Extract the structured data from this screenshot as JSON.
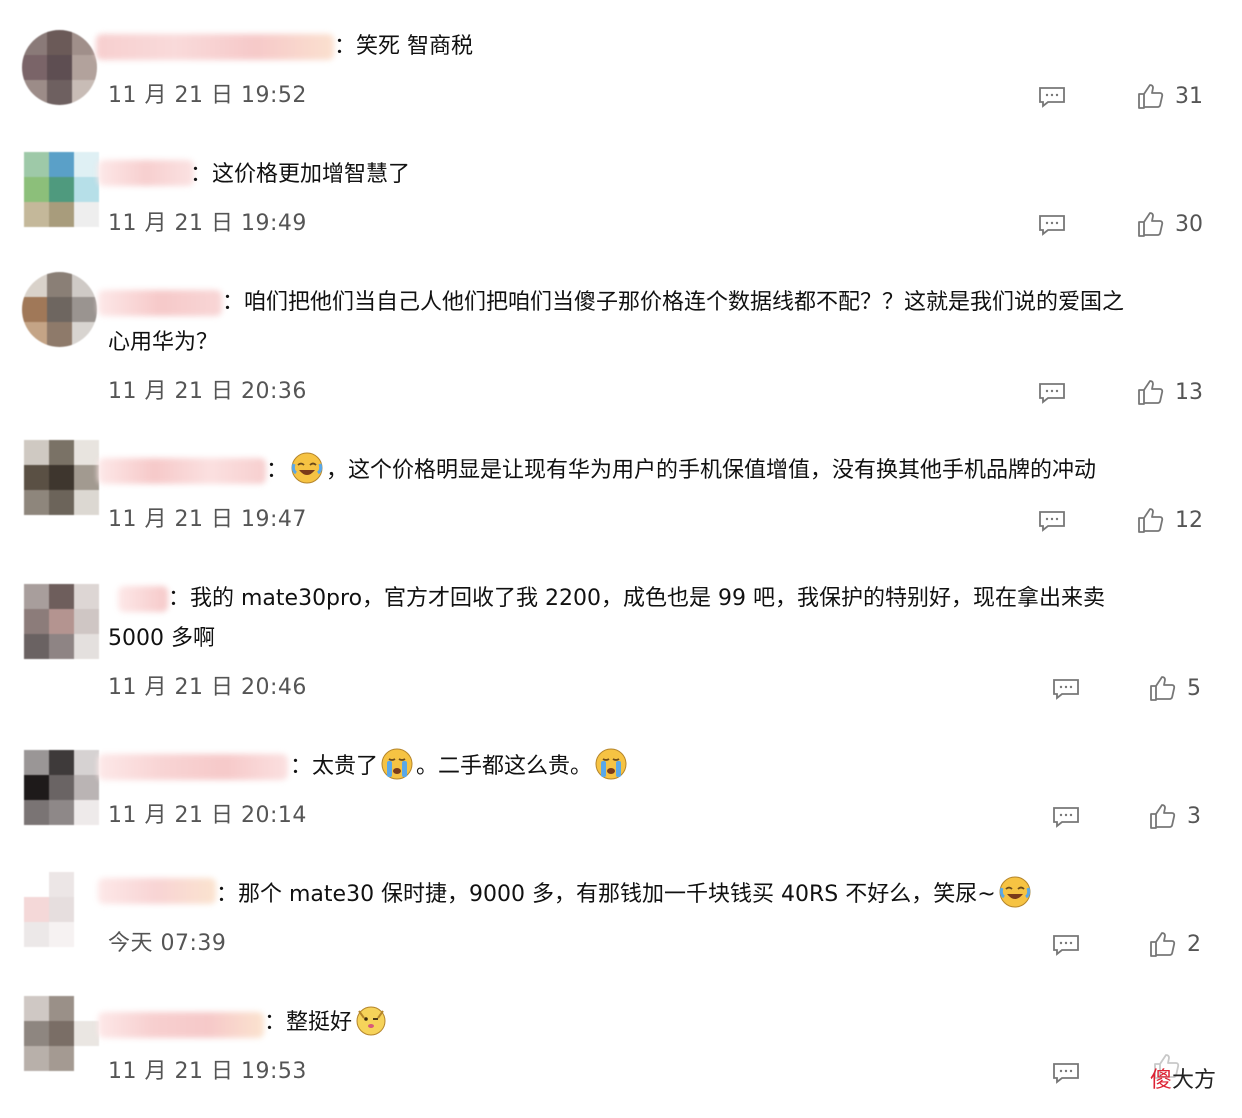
{
  "comments": [
    {
      "text_parts": [
        "：笑死 智商税"
      ],
      "time": "11 月 21 日 19:52",
      "like_count": "31"
    },
    {
      "text_parts": [
        "：这价格更加增智慧了"
      ],
      "time": "11 月 21 日 19:49",
      "like_count": "30"
    },
    {
      "text_line1": "：咱们把他们当自己人他们把咱们当傻子那价格连个数据线都不配？？这就是我们说的爱国之",
      "text_line2": "心用华为？",
      "time": "11 月 21 日 20:36",
      "like_count": "13"
    },
    {
      "text_before": "：",
      "text_after": "，这个价格明显是让现有华为用户的手机保值增值，没有换其他手机品牌的冲动",
      "emoji": "laughing-crying-emoji",
      "time": "11 月 21 日 19:47",
      "like_count": "12"
    },
    {
      "text_line1": "：我的 mate30pro，官方才回收了我 2200，成色也是 99 吧，我保护的特别好，现在拿出来卖",
      "text_line2": "5000 多啊",
      "time": "11 月 21 日 20:46",
      "like_count": "5"
    },
    {
      "text_a": "：太贵了",
      "text_b": "。二手都这么贵。",
      "emoji": "crying-emoji",
      "time": "11 月 21 日 20:14",
      "like_count": "3"
    },
    {
      "text_a": "：那个 mate30 保时捷，9000 多，有那钱加一千块钱买 40RS 不好么，笑尿~",
      "emoji": "laughing-crying-emoji",
      "time": "今天 07:39",
      "like_count": "2"
    },
    {
      "text_a": "：整挺好",
      "emoji": "doge-emoji",
      "time": "11 月 21 日 19:53",
      "like_count": ""
    }
  ],
  "watermark": {
    "char1": "傻",
    "rest": "大方"
  },
  "colors": {
    "icon_gray": "#777777",
    "blur_pink": "#f6c9c9",
    "emoji_yellow": "#f6c343"
  }
}
